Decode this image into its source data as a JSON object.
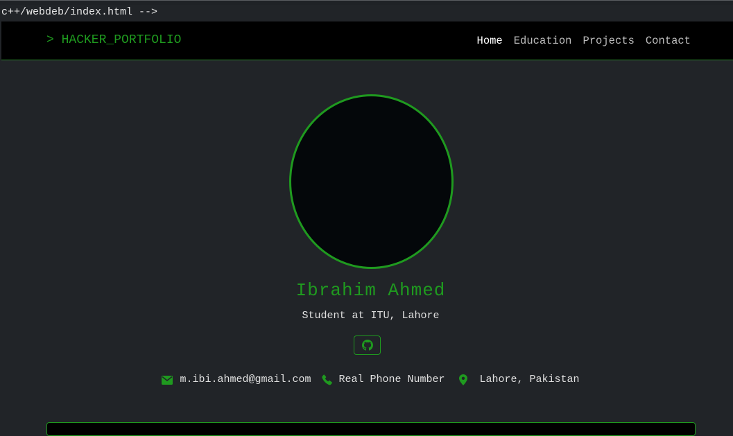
{
  "path_bar": {
    "text": "c++/webdeb/index.html -->"
  },
  "navbar": {
    "brand": "> HACKER_PORTFOLIO",
    "links": [
      {
        "label": "Home",
        "active": true
      },
      {
        "label": "Education",
        "active": false
      },
      {
        "label": "Projects",
        "active": false
      },
      {
        "label": "Contact",
        "active": false
      }
    ]
  },
  "profile": {
    "name": "Ibrahim Ahmed",
    "subtitle": "Student at ITU, Lahore",
    "github_icon": "github-icon"
  },
  "contact": {
    "email": "m.ibi.ahmed@gmail.com",
    "phone": "Real Phone Number",
    "location": "Lahore, Pakistan",
    "icons": [
      "envelope-icon",
      "phone-icon",
      "map-pin-icon"
    ]
  },
  "colors": {
    "accent": "#1f9a1f",
    "background": "#212428",
    "navbar": "#000000",
    "text": "#e0e0e0"
  }
}
